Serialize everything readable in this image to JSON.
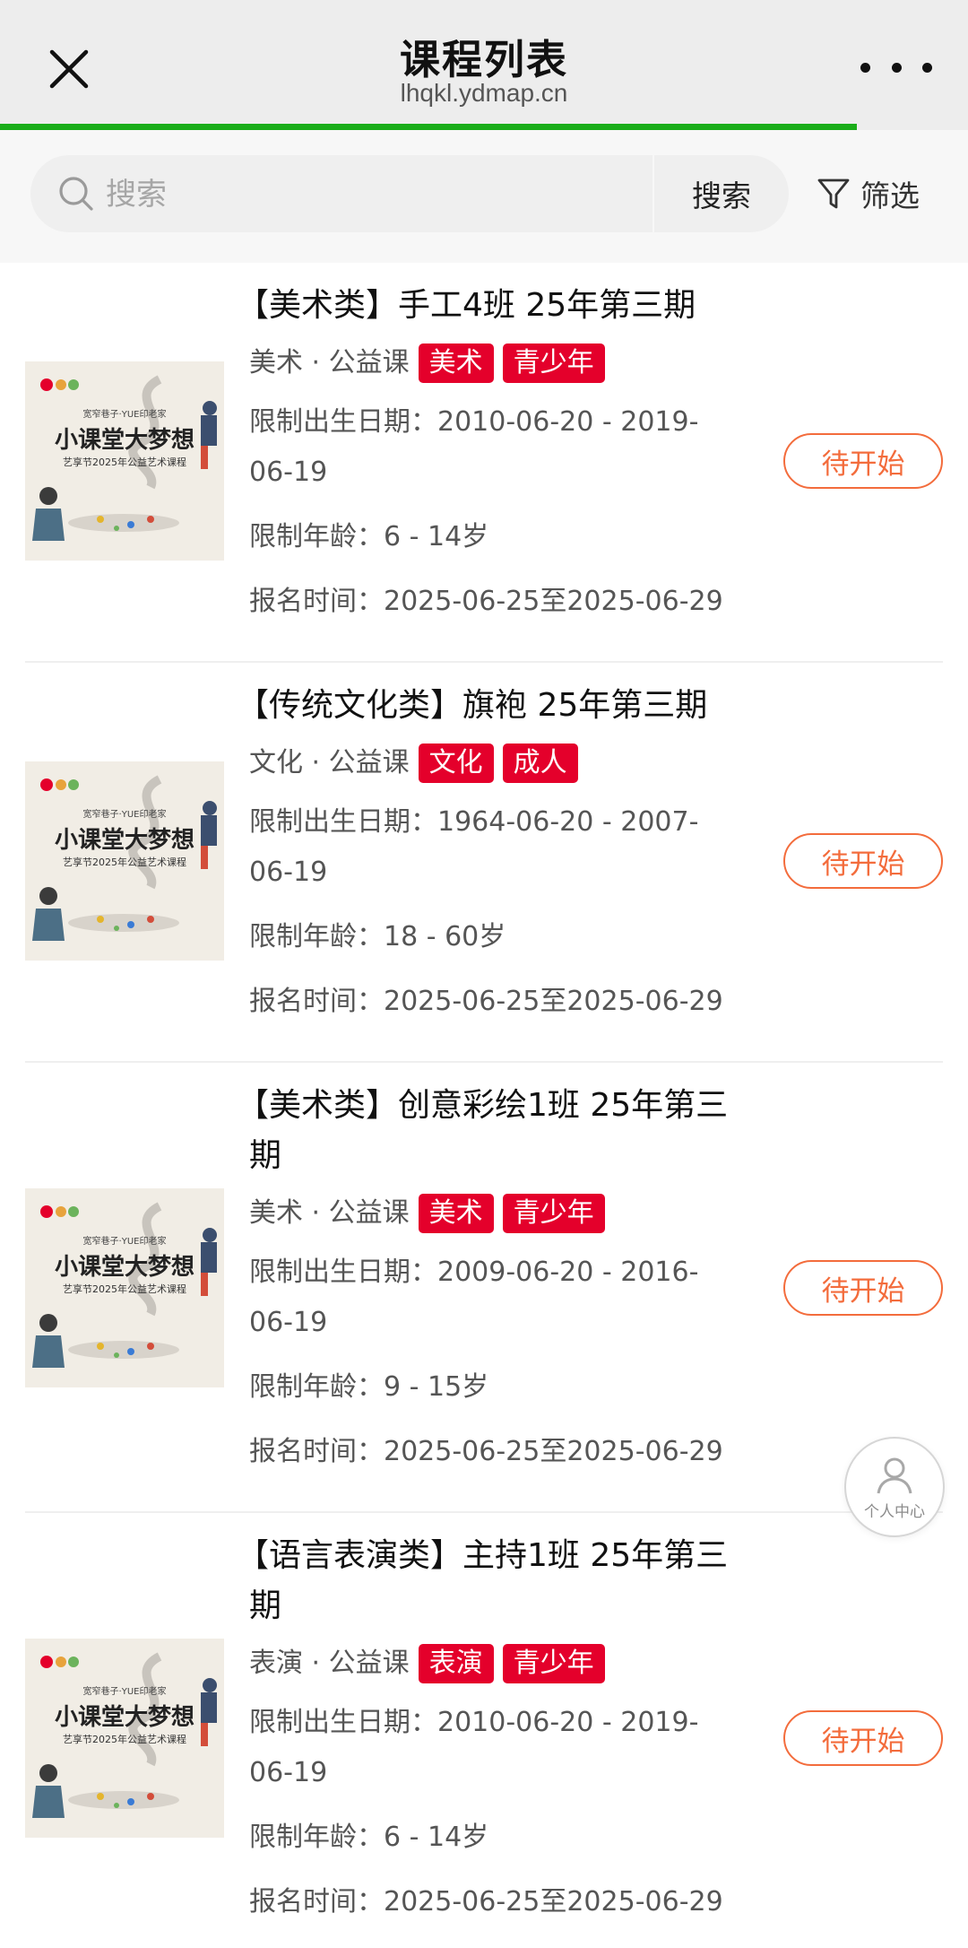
{
  "navbar": {
    "title": "课程列表",
    "url": "lhqkl.ydmap.cn",
    "close_icon": "close-icon",
    "more_icon": "more-dots-icon",
    "load_progress_percent": 88.5,
    "progress_color": "#1aad19"
  },
  "search": {
    "placeholder": "搜索",
    "value": "",
    "button_label": "搜索",
    "filter_label": "筛选",
    "icon": "search-icon",
    "filter_icon": "filter-funnel-icon"
  },
  "colors": {
    "tag_red": "#e4002b",
    "status_orange": "#f36c3c"
  },
  "courses": [
    {
      "title": "【美术类】手工4班 25年第三期",
      "category": "美术 · 公益课",
      "tags": [
        "美术",
        "青少年"
      ],
      "birth_limit_line1": "限制出生日期：2010-06-20 - 2019-",
      "birth_limit_line2": "06-19",
      "age_limit": "限制年龄：6 - 14岁",
      "signup_time": "报名时间：2025-06-25至2025-06-29",
      "status": "待开始"
    },
    {
      "title": "【传统文化类】旗袍 25年第三期",
      "category": "文化 · 公益课",
      "tags": [
        "文化",
        "成人"
      ],
      "birth_limit_line1": "限制出生日期：1964-06-20 - 2007-",
      "birth_limit_line2": "06-19",
      "age_limit": "限制年龄：18 - 60岁",
      "signup_time": "报名时间：2025-06-25至2025-06-29",
      "status": "待开始"
    },
    {
      "title_line1": "【美术类】创意彩绘1班 25年第三",
      "title_line2": "期",
      "category": "美术 · 公益课",
      "tags": [
        "美术",
        "青少年"
      ],
      "birth_limit_line1": "限制出生日期：2009-06-20 - 2016-",
      "birth_limit_line2": "06-19",
      "age_limit": "限制年龄：9 - 15岁",
      "signup_time": "报名时间：2025-06-25至2025-06-29",
      "status": "待开始"
    },
    {
      "title_line1": "【语言表演类】主持1班 25年第三",
      "title_line2": "期",
      "category": "表演 · 公益课",
      "tags": [
        "表演",
        "青少年"
      ],
      "birth_limit_line1": "限制出生日期：2010-06-20 - 2019-",
      "birth_limit_line2": "06-19",
      "age_limit": "限制年龄：6 - 14岁",
      "signup_time": "报名时间：2025-06-25至2025-06-29",
      "status": "待开始"
    }
  ],
  "poster": {
    "big_text": "小课堂大梦想",
    "small_text": "宽窄巷子·YUE印老家",
    "sub_text": "艺享节2025年公益艺术课程"
  },
  "personal_center": {
    "label": "个人中心",
    "icon": "user-icon"
  }
}
